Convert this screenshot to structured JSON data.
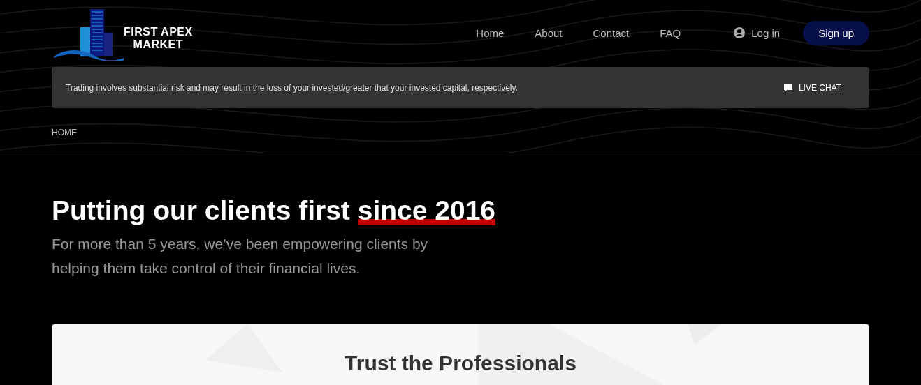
{
  "logo": {
    "line_1": "FIRST APEX",
    "line_2": "MARKET"
  },
  "nav": [
    {
      "label": "Home"
    },
    {
      "label": "About"
    },
    {
      "label": "Contact"
    },
    {
      "label": "FAQ"
    }
  ],
  "login": "Log in",
  "signup": "Sign up",
  "risk_notice": "Trading involves substantial risk and may result in the loss of your invested/greater that your invested capital, respectively.",
  "live_chat": "LIVE CHAT",
  "breadcrumb": "HOME",
  "hero": {
    "heading": "Putting our clients first",
    "heading_highlight": "since 2016",
    "text": "For more than 5 years, we’ve been empowering clients by helping them take control of their financial lives."
  },
  "card": {
    "title": "Trust the Professionals"
  }
}
